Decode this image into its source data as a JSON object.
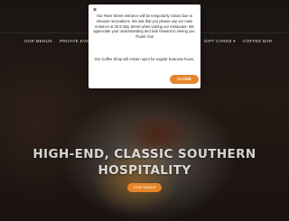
{
  "nav": {
    "items": [
      "OUR MENUS",
      "PRIVATE EVENTS",
      "GIFT CARDS ▾",
      "COFFEE BAR"
    ]
  },
  "hero": {
    "headline_line1": "HIGH-END, CLASSIC SOUTHERN",
    "headline_line2": "HOSPITALITY",
    "button_label": "VIEW MENUS"
  },
  "modal": {
    "close_glyph": "×",
    "paragraph1": "Our River Street entrance will be temporarily closed due to elevator renovations. We ask that you please use our main entrance at 26 E Bay Street when visiting our restaurant. We appreciate your understanding and look forward to seeing you. Thank You!",
    "paragraph2": "Our Coffee Shop will remain open for regular business hours.",
    "close_button_label": "CLOSE"
  },
  "colors": {
    "accent": "#e5852a",
    "modal_bg": "#ffffff",
    "nav_text": "#e9e3d8"
  }
}
